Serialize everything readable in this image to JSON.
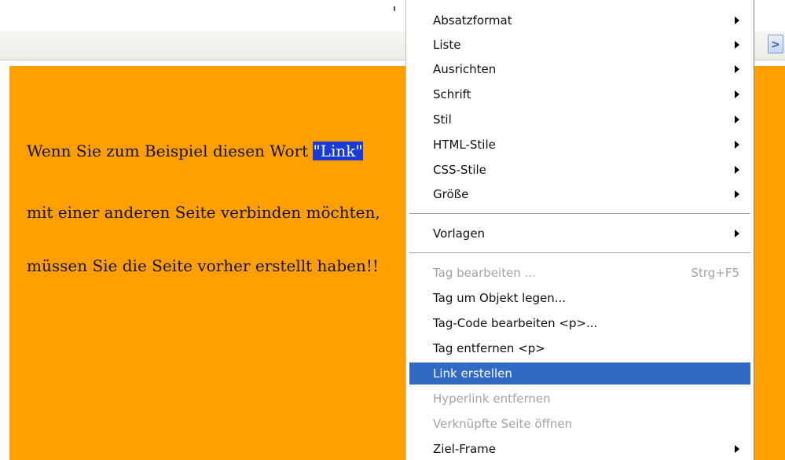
{
  "document": {
    "line1_before": "Wenn Sie zum Beispiel diesen Wort ",
    "line1_selected": "\"Link\"",
    "line2": "mit einer anderen Seite verbinden möchten,",
    "line3": "müssen Sie die Seite vorher erstellt haben!!"
  },
  "toolbar": {
    "scroll_right_glyph": ">"
  },
  "context_menu": {
    "items": [
      {
        "label": "Absatzformat",
        "submenu": true,
        "disabled": false
      },
      {
        "label": "Liste",
        "submenu": true,
        "disabled": false
      },
      {
        "label": "Ausrichten",
        "submenu": true,
        "disabled": false
      },
      {
        "label": "Schrift",
        "submenu": true,
        "disabled": false
      },
      {
        "label": "Stil",
        "submenu": true,
        "disabled": false
      },
      {
        "label": "HTML-Stile",
        "submenu": true,
        "disabled": false
      },
      {
        "label": "CSS-Stile",
        "submenu": true,
        "disabled": false
      },
      {
        "label": "Größe",
        "submenu": true,
        "disabled": false
      },
      {
        "label": "Vorlagen",
        "submenu": true,
        "disabled": false
      },
      {
        "label": "Tag bearbeiten ...",
        "shortcut": "Strg+F5",
        "disabled": true
      },
      {
        "label": "Tag um Objekt legen...",
        "disabled": false
      },
      {
        "label": "Tag-Code bearbeiten <p>...",
        "disabled": false
      },
      {
        "label": "Tag entfernen <p>",
        "disabled": false
      },
      {
        "label": "Link erstellen",
        "disabled": false,
        "highlighted": true
      },
      {
        "label": "Hyperlink entfernen",
        "disabled": true
      },
      {
        "label": "Verknüpfte Seite öffnen",
        "disabled": true
      },
      {
        "label": "Ziel-Frame",
        "submenu": true,
        "disabled": false
      }
    ]
  },
  "colors": {
    "canvas_background": "#ff9f00",
    "selection": "#1a3cd6",
    "menu_highlight": "#316ac5",
    "disabled_text": "#a3a3a3"
  },
  "icons": {
    "submenu": "triangle-right-icon",
    "scroll_right": "chevron-right-icon"
  }
}
